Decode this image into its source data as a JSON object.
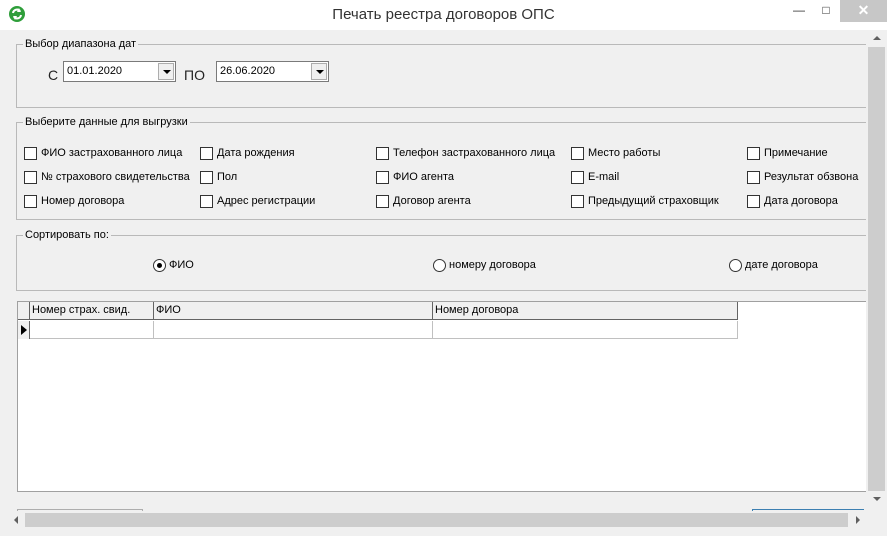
{
  "window": {
    "title": "Печать реестра договоров ОПС",
    "minimize_glyph": "—",
    "maximize_glyph": "□",
    "close_glyph": "✕",
    "icon": "refresh-arrows-icon",
    "accent_color": "#2e9e3a"
  },
  "date_range": {
    "legend": "Выбор диапазона дат",
    "from_label": "С",
    "from_value": "01.01.2020",
    "to_label": "ПО",
    "to_value": "26.06.2020"
  },
  "export_data": {
    "legend": "Выберите данные для выгрузки",
    "checkboxes": [
      {
        "label": "ФИО застрахованного лица",
        "checked": false
      },
      {
        "label": "№ страхового свидетельства",
        "checked": false
      },
      {
        "label": "Номер договора",
        "checked": false
      },
      {
        "label": "Дата рождения",
        "checked": false
      },
      {
        "label": "Пол",
        "checked": false
      },
      {
        "label": "Адрес регистрации",
        "checked": false
      },
      {
        "label": "Телефон застрахованного лица",
        "checked": false
      },
      {
        "label": "ФИО агента",
        "checked": false
      },
      {
        "label": "Договор агента",
        "checked": false
      },
      {
        "label": "Место работы",
        "checked": false
      },
      {
        "label": "E-mail",
        "checked": false
      },
      {
        "label": "Предыдущий страховщик",
        "checked": false
      },
      {
        "label": "Примечание",
        "checked": false
      },
      {
        "label": "Результат обзвона",
        "checked": false
      },
      {
        "label": "Дата договора",
        "checked": false
      }
    ]
  },
  "sort": {
    "legend": "Сортировать по:",
    "options": [
      {
        "label": "ФИО",
        "selected": true
      },
      {
        "label": "номеру договора",
        "selected": false
      },
      {
        "label": "дате договора",
        "selected": false
      }
    ]
  },
  "grid": {
    "columns": [
      "Номер страх. свид.",
      "ФИО",
      "Номер договора"
    ],
    "rows": [
      [
        "",
        "",
        ""
      ]
    ]
  }
}
